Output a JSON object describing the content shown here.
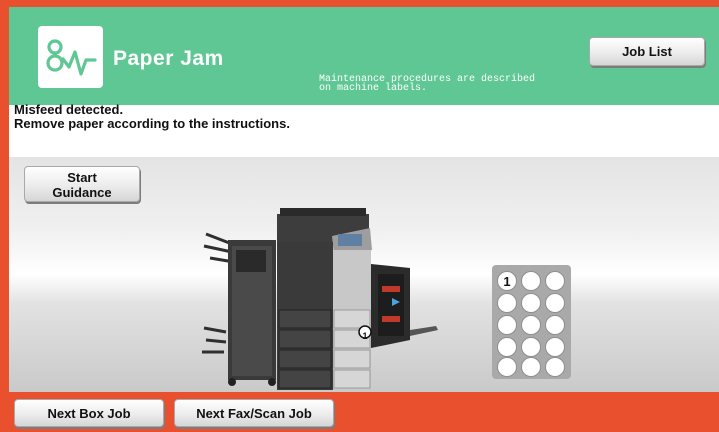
{
  "header": {
    "logo_icon": "paper-jam-wave-icon",
    "title": "Paper Jam",
    "maintenance_note": "Maintenance procedures are described\non machine labels.",
    "job_list_label": "Job List",
    "accent_color": "#5ec793",
    "frame_color": "#e8502e"
  },
  "message": {
    "line1": "Misfeed detected.",
    "line2": "Remove paper according to the instructions."
  },
  "guidance": {
    "label_line1": "Start",
    "label_line2": "Guidance"
  },
  "illustration": {
    "jam_marker": "1",
    "tray_indicator": {
      "highlighted": "1",
      "slots": 15
    }
  },
  "footer": {
    "next_box_label": "Next Box Job",
    "next_fax_label": "Next Fax/Scan Job"
  }
}
